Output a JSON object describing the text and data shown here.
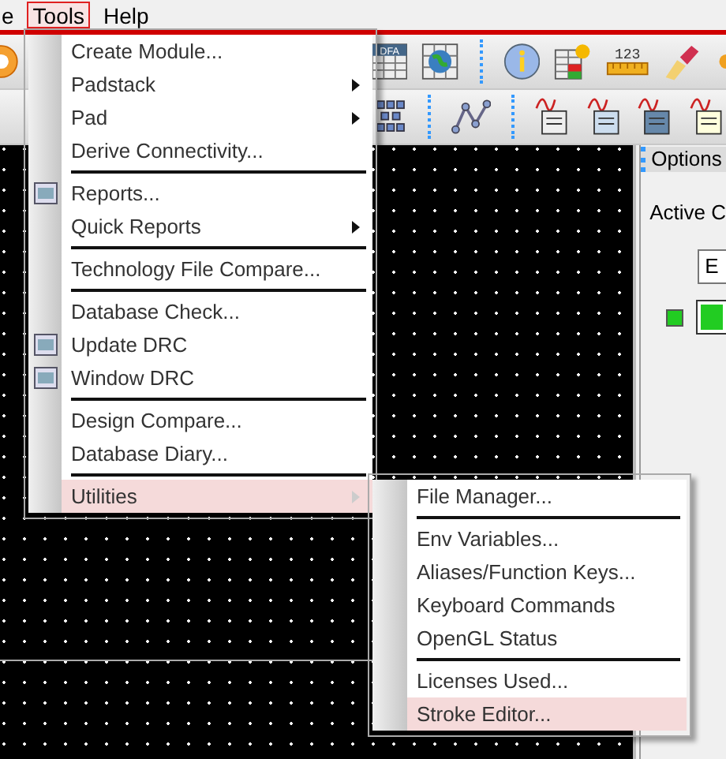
{
  "menubar": [
    {
      "label": "e",
      "selected": false
    },
    {
      "label": "Tools",
      "selected": true
    },
    {
      "label": "Help",
      "selected": false
    }
  ],
  "toolbar_texts": [
    "DFA",
    "123"
  ],
  "tools_menu": [
    {
      "kind": "item",
      "label": "Create Module...",
      "has_icon": false,
      "submenu": false,
      "selected": false
    },
    {
      "kind": "item",
      "label": "Padstack",
      "has_icon": false,
      "submenu": true,
      "selected": false
    },
    {
      "kind": "item",
      "label": "Pad",
      "has_icon": false,
      "submenu": true,
      "selected": false
    },
    {
      "kind": "item",
      "label": "Derive Connectivity...",
      "has_icon": false,
      "submenu": false,
      "selected": false
    },
    {
      "kind": "separator"
    },
    {
      "kind": "item",
      "label": "Reports...",
      "has_icon": true,
      "submenu": false,
      "selected": false
    },
    {
      "kind": "item",
      "label": "Quick Reports",
      "has_icon": false,
      "submenu": true,
      "selected": false
    },
    {
      "kind": "separator"
    },
    {
      "kind": "item",
      "label": "Technology File Compare...",
      "has_icon": false,
      "submenu": false,
      "selected": false
    },
    {
      "kind": "separator"
    },
    {
      "kind": "item",
      "label": "Database Check...",
      "has_icon": false,
      "submenu": false,
      "selected": false
    },
    {
      "kind": "item",
      "label": "Update DRC",
      "has_icon": true,
      "submenu": false,
      "selected": false
    },
    {
      "kind": "item",
      "label": "Window DRC",
      "has_icon": true,
      "submenu": false,
      "selected": false
    },
    {
      "kind": "separator"
    },
    {
      "kind": "item",
      "label": "Design Compare...",
      "has_icon": false,
      "submenu": false,
      "selected": false
    },
    {
      "kind": "item",
      "label": "Database Diary...",
      "has_icon": false,
      "submenu": false,
      "selected": false
    },
    {
      "kind": "separator"
    },
    {
      "kind": "item",
      "label": "Utilities",
      "has_icon": false,
      "submenu": true,
      "selected": true
    }
  ],
  "utilities_menu": [
    {
      "kind": "item",
      "label": "File Manager...",
      "selected": false
    },
    {
      "kind": "separator"
    },
    {
      "kind": "item",
      "label": "Env Variables...",
      "selected": false
    },
    {
      "kind": "item",
      "label": "Aliases/Function Keys...",
      "selected": false
    },
    {
      "kind": "item",
      "label": "Keyboard Commands",
      "selected": false
    },
    {
      "kind": "item",
      "label": "OpenGL Status",
      "selected": false
    },
    {
      "kind": "separator"
    },
    {
      "kind": "item",
      "label": "Licenses Used...",
      "selected": false
    },
    {
      "kind": "item",
      "label": "Stroke Editor...",
      "selected": true
    }
  ],
  "options_panel": {
    "title": "Options",
    "active_label": "Active C",
    "field_value": "E",
    "indicator": {
      "color": "#22cc22"
    }
  }
}
